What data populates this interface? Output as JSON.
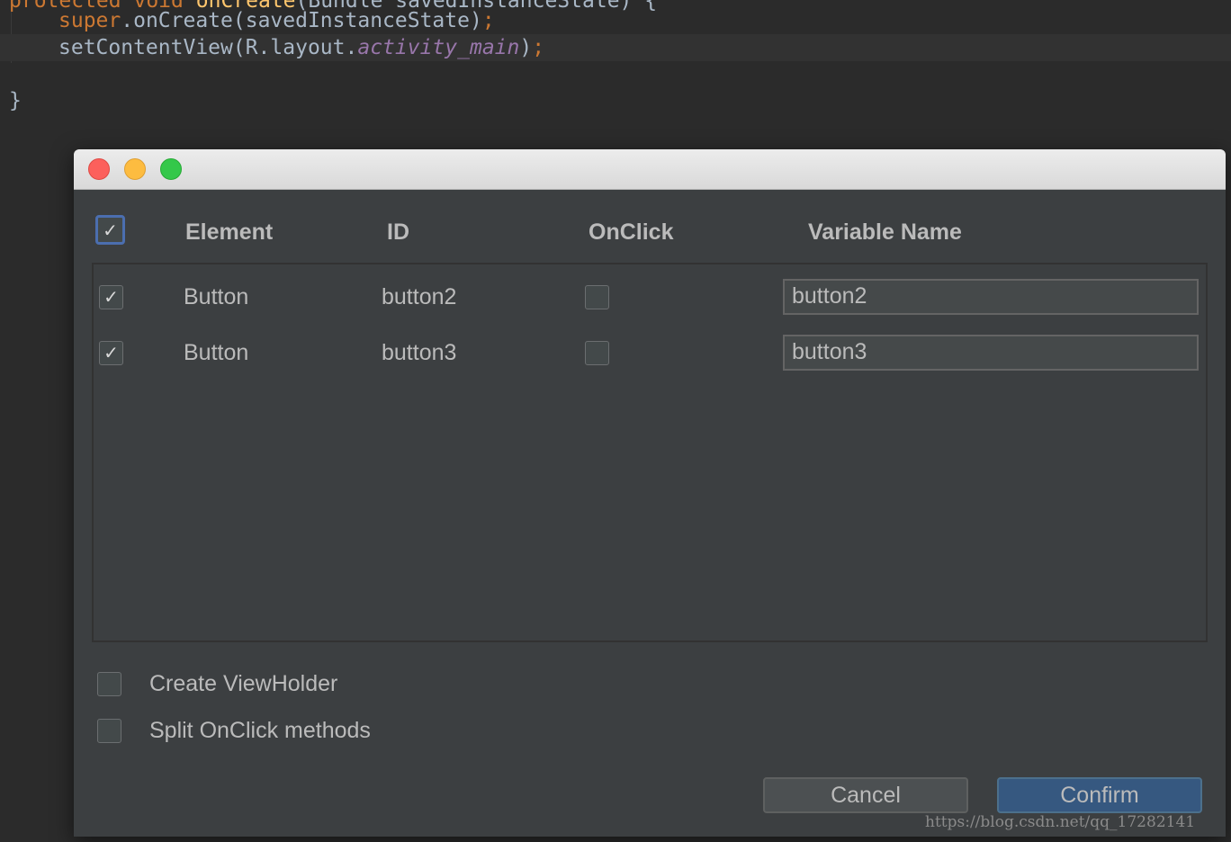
{
  "editor": {
    "line0": {
      "kw1": "protected",
      "kw2": "void",
      "fn": "onCreate",
      "rest": "(Bundle savedInstanceState) {"
    },
    "line1": {
      "kw": "super",
      "rest": ".onCreate(savedInstanceState)",
      "semi": ";"
    },
    "line2": {
      "pre": "setContentView(R.layout.",
      "field": "activity_main",
      "post": ")",
      "semi": ";"
    },
    "line3": {
      "text": "}"
    }
  },
  "dialog": {
    "headers": {
      "element": "Element",
      "id": "ID",
      "onclick": "OnClick",
      "variable_name": "Variable Name"
    },
    "select_all_checked": "✓",
    "rows": [
      {
        "checked": "✓",
        "element": "Button",
        "id": "button2",
        "onclick": "",
        "variable_name": "button2"
      },
      {
        "checked": "✓",
        "element": "Button",
        "id": "button3",
        "onclick": "",
        "variable_name": "button3"
      }
    ],
    "options": {
      "create_viewholder": "Create ViewHolder",
      "split_onclick": "Split OnClick methods"
    },
    "buttons": {
      "cancel": "Cancel",
      "confirm": "Confirm"
    }
  },
  "watermark": "https://blog.csdn.net/qq_17282141"
}
